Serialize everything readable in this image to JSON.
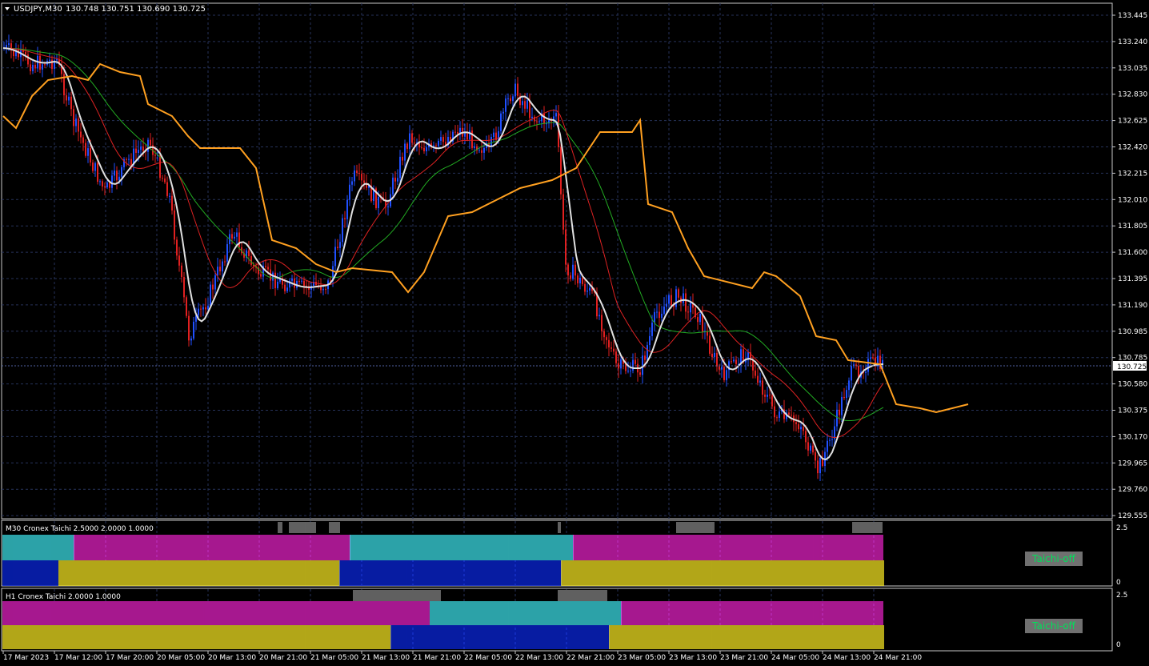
{
  "header": {
    "symbol_tf": "USDJPY,M30",
    "ohlc": "130.748 130.751 130.690 130.725"
  },
  "main": {
    "price_ticks": [
      "133.445",
      "133.240",
      "133.035",
      "132.830",
      "132.625",
      "132.420",
      "132.215",
      "132.010",
      "131.805",
      "131.600",
      "131.395",
      "131.190",
      "130.985",
      "130.785",
      "130.580",
      "130.375",
      "130.170",
      "129.965",
      "129.760",
      "129.555"
    ],
    "current_price": "130.725",
    "colors": {
      "bull": "#2050ff",
      "bear": "#e02020",
      "envelope": "#ffa020",
      "ma_fast": "#e0e0e0",
      "ma_mid": "#dd2222",
      "ma_slow": "#22aa22",
      "grid": "#26325a"
    }
  },
  "indicator1": {
    "title": "M30 Cronex Taichi 2.5000 2.0000 1.0000",
    "scale_top": "2.5",
    "scale_bottom": "0",
    "button": "Taichi-off"
  },
  "indicator2": {
    "title": "H1 Cronex Taichi 2.0000 1.0000",
    "scale_top": "2.5",
    "scale_bottom": "0",
    "button": "Taichi-off"
  },
  "time_axis": [
    "17 Mar 2023",
    "17 Mar 12:00",
    "17 Mar 20:00",
    "20 Mar 05:00",
    "20 Mar 13:00",
    "20 Mar 21:00",
    "21 Mar 05:00",
    "21 Mar 13:00",
    "21 Mar 21:00",
    "22 Mar 05:00",
    "22 Mar 13:00",
    "22 Mar 21:00",
    "23 Mar 05:00",
    "23 Mar 13:00",
    "23 Mar 21:00",
    "24 Mar 05:00",
    "24 Mar 13:00",
    "24 Mar 21:00"
  ]
}
